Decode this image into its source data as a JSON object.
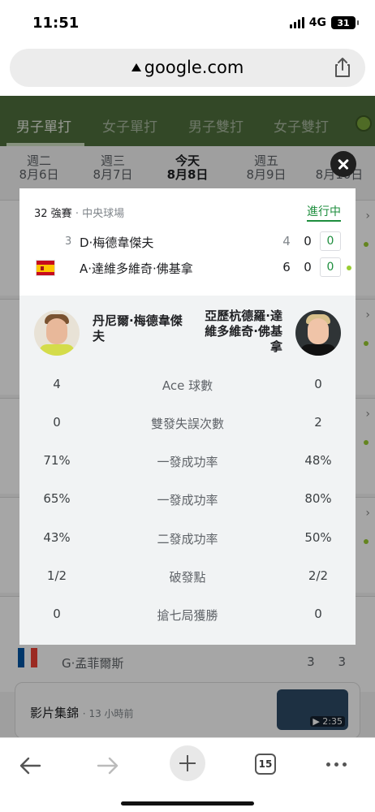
{
  "status": {
    "time": "11:51",
    "network": "4G",
    "battery": "31"
  },
  "browser": {
    "url": "google.com",
    "tab_count": "15"
  },
  "tabs": [
    "男子單打",
    "女子單打",
    "男子雙打",
    "女子雙打"
  ],
  "dates": [
    {
      "day": "週二",
      "date": "8月6日"
    },
    {
      "day": "週三",
      "date": "8月7日"
    },
    {
      "day": "今天",
      "date": "8月8日"
    },
    {
      "day": "週五",
      "date": "8月9日"
    },
    {
      "day": "週",
      "date": "8月10日"
    }
  ],
  "match": {
    "round": "32 強賽",
    "venue": "中央球場",
    "status": "進行中",
    "player1": {
      "seed": "3",
      "name": "D·梅德韋傑夫",
      "set1": "4",
      "set2": "0",
      "game": "0"
    },
    "player2": {
      "name": "A·達維多維奇·佛基拿",
      "set1": "6",
      "set2": "0",
      "game": "0"
    }
  },
  "stats": {
    "left_player": "丹尼爾·梅德韋傑夫",
    "right_player": "亞歷杭德羅·達維多維奇·佛基拿",
    "rows": [
      {
        "label": "Ace 球數",
        "left": "4",
        "right": "0"
      },
      {
        "label": "雙發失誤次數",
        "left": "0",
        "right": "2"
      },
      {
        "label": "一發成功率",
        "left": "71%",
        "right": "48%"
      },
      {
        "label": "一發成功率",
        "left": "65%",
        "right": "80%"
      },
      {
        "label": "二發成功率",
        "left": "43%",
        "right": "50%"
      },
      {
        "label": "破發點",
        "left": "1/2",
        "right": "2/2"
      },
      {
        "label": "搶七局獲勝",
        "left": "0",
        "right": "0"
      }
    ]
  },
  "background": {
    "player_name": "G·孟菲爾斯",
    "player_score": "3 3",
    "video_title": "影片集錦",
    "video_meta": "13 小時前",
    "video_duration": "2:35"
  }
}
